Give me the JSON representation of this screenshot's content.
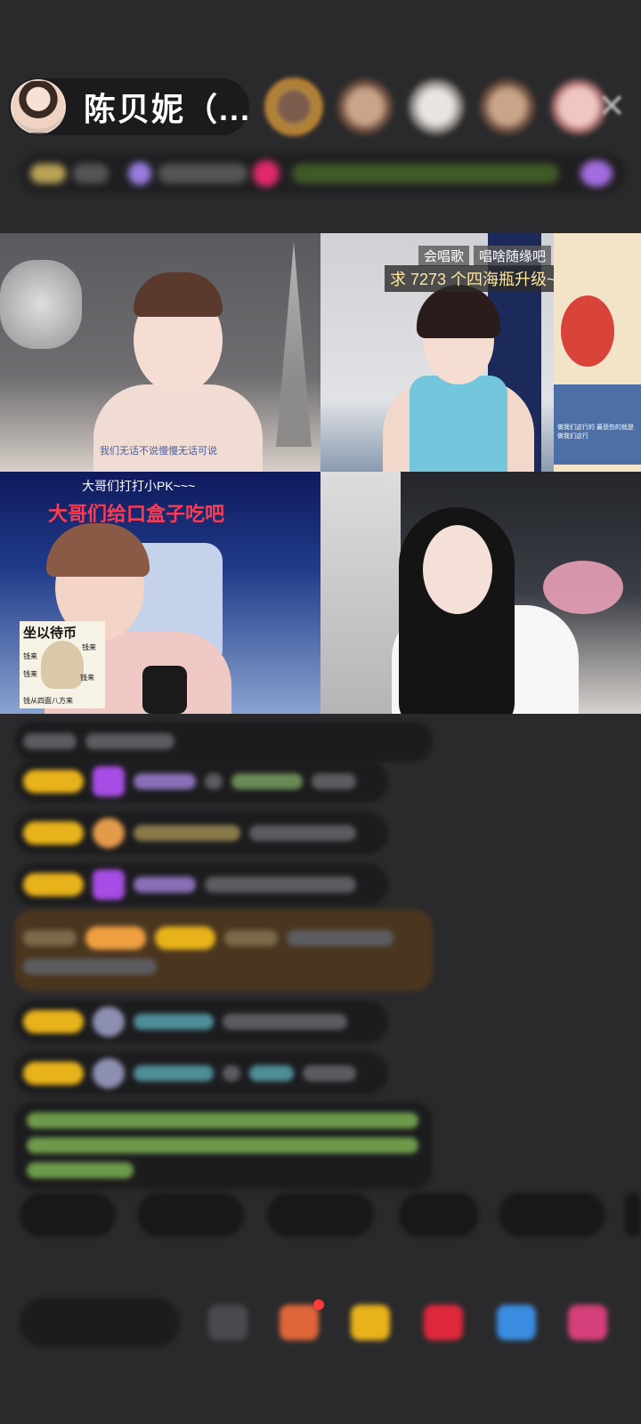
{
  "header": {
    "host_name": "陈贝妮（..."
  },
  "streams": {
    "top_right_tag1": "会唱歌",
    "top_right_tag2": "唱啥随缘吧",
    "top_right_goal": "求 7273 个四海瓶升级~",
    "top_left_caption": "我们无话不说慢慢无话可说",
    "bottom_left_line1": "大哥们打打小PK~~~",
    "bottom_left_line2": "大哥们给口盒子吃吧",
    "sticker_title": "坐以待币",
    "sticker_lines": [
      "钱来",
      "钱来",
      "钱来",
      "钱来",
      "钱从四面八方来"
    ],
    "side_sticker_text": "做我们这行的 最悲伤的就是做我们这行"
  },
  "colors": {
    "background": "#2a2a2c",
    "badge": "#e8b21a",
    "accent_red": "#e0283c"
  }
}
